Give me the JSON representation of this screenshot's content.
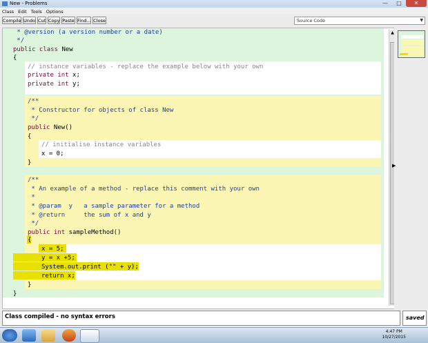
{
  "window": {
    "title": "New - Problems"
  },
  "menu": [
    "Class",
    "Edit",
    "Tools",
    "Options"
  ],
  "toolbar": {
    "compile": "Compile",
    "undo": "Undo",
    "cut": "Cut",
    "copy": "Copy",
    "paste": "Paste",
    "find": "Find...",
    "close": "Close",
    "view_selected": "Source Code"
  },
  "code": {
    "l1": " * @version (a version number or a date)",
    "l2": " */",
    "l3a": "public class",
    "l3b": " New",
    "l4": "{",
    "f1": "// instance variables - replace the example below with your own",
    "f2a": "private int",
    "f2b": " x;",
    "f3a": "private int",
    "f3b": " y;",
    "c1": "/**",
    "c2": " * Constructor for objects of class New",
    "c3": " */",
    "c4a": "public",
    "c4b": " New()",
    "c5": "{",
    "c6": "// initialise instance variables",
    "c7": "x = 0;",
    "c8": "}",
    "m1": "/**",
    "m2": " * An example of a method - replace this comment with your own",
    "m3": " *",
    "m4": " * @param  y   a sample parameter for a method",
    "m5": " * @return     the sum of x and y",
    "m6": " */",
    "m7a": "public int",
    "m7b": " sampleMethod()",
    "m8": "{",
    "m9": "x = 5;",
    "m10": "y = x +5;",
    "m11": "System.out.print (\"\" + y);",
    "m12": "return x;",
    "m13": "}",
    "end": "}"
  },
  "status": {
    "message": "Class compiled - no syntax errors",
    "saved": "saved"
  },
  "taskbar": {
    "time": "4:47 PM",
    "date": "10/27/2015"
  },
  "colors": {
    "class_scope": "#dcf5dc",
    "method_scope": "#fbf6b4",
    "highlight": "#e8e000",
    "comment": "#1d3fa0",
    "keyword": "#7a0a3a"
  }
}
